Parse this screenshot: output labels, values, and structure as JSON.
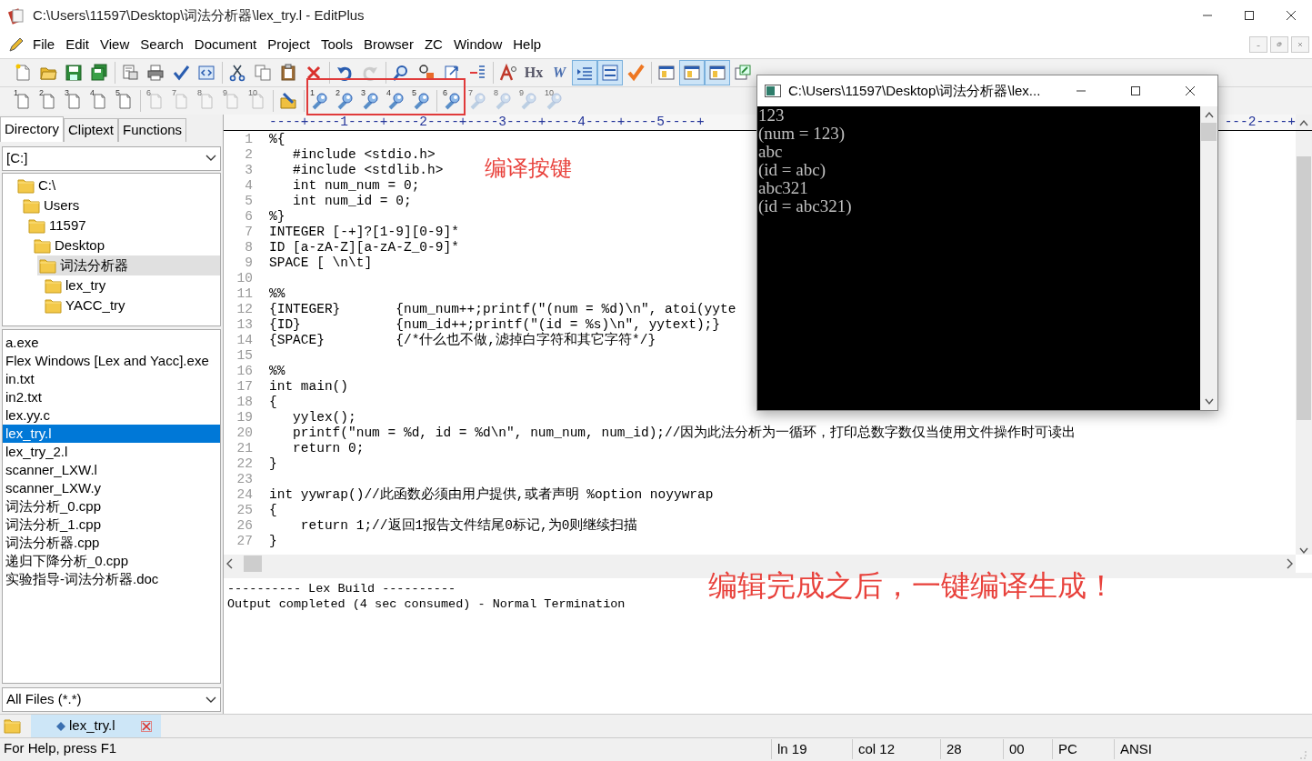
{
  "window": {
    "title": "C:\\Users\\11597\\Desktop\\词法分析器\\lex_try.l - EditPlus"
  },
  "menu": [
    "File",
    "Edit",
    "View",
    "Search",
    "Document",
    "Project",
    "Tools",
    "Browser",
    "ZC",
    "Window",
    "Help"
  ],
  "toolbar_main": [
    {
      "kind": "new",
      "pressed": false,
      "disabled": false
    },
    {
      "kind": "open",
      "pressed": false,
      "disabled": false
    },
    {
      "kind": "save",
      "pressed": false,
      "disabled": false
    },
    {
      "kind": "saveall",
      "pressed": false,
      "disabled": false
    },
    {
      "kind": "sep"
    },
    {
      "kind": "preview",
      "pressed": false,
      "disabled": false
    },
    {
      "kind": "print",
      "pressed": false,
      "disabled": false
    },
    {
      "kind": "spell",
      "pressed": false,
      "disabled": false
    },
    {
      "kind": "browser",
      "pressed": false,
      "disabled": false
    },
    {
      "kind": "sep"
    },
    {
      "kind": "cut",
      "pressed": false,
      "disabled": false
    },
    {
      "kind": "copy",
      "pressed": false,
      "disabled": false
    },
    {
      "kind": "paste",
      "pressed": false,
      "disabled": false
    },
    {
      "kind": "delete",
      "pressed": false,
      "disabled": false
    },
    {
      "kind": "sep"
    },
    {
      "kind": "undo",
      "pressed": false,
      "disabled": false
    },
    {
      "kind": "redo",
      "pressed": false,
      "disabled": true
    },
    {
      "kind": "sep"
    },
    {
      "kind": "find",
      "pressed": false,
      "disabled": false
    },
    {
      "kind": "replace",
      "pressed": false,
      "disabled": false
    },
    {
      "kind": "goto",
      "pressed": false,
      "disabled": false
    },
    {
      "kind": "linelist",
      "pressed": false,
      "disabled": false
    },
    {
      "kind": "sep"
    },
    {
      "kind": "font",
      "pressed": false,
      "disabled": false
    },
    {
      "kind": "hex",
      "label": "Hx",
      "pressed": false,
      "disabled": false
    },
    {
      "kind": "wrap",
      "label": "W",
      "pressed": false,
      "disabled": false
    },
    {
      "kind": "indent",
      "pressed": true,
      "disabled": false
    },
    {
      "kind": "linenum",
      "pressed": true,
      "disabled": false
    },
    {
      "kind": "check",
      "pressed": false,
      "disabled": false
    },
    {
      "kind": "sep"
    },
    {
      "kind": "pane",
      "pressed": false,
      "disabled": false
    },
    {
      "kind": "pane",
      "pressed": true,
      "disabled": false
    },
    {
      "kind": "pane",
      "pressed": true,
      "disabled": false
    },
    {
      "kind": "window",
      "pressed": false,
      "disabled": false
    }
  ],
  "toolbar_tools": [
    {
      "kind": "doc",
      "label": "1",
      "disabled": false
    },
    {
      "kind": "doc",
      "label": "2",
      "disabled": false
    },
    {
      "kind": "doc",
      "label": "3",
      "disabled": false
    },
    {
      "kind": "doc",
      "label": "4",
      "disabled": false
    },
    {
      "kind": "doc",
      "label": "5",
      "disabled": false
    },
    {
      "kind": "sep"
    },
    {
      "kind": "doc",
      "label": "6",
      "disabled": true
    },
    {
      "kind": "doc",
      "label": "7",
      "disabled": true
    },
    {
      "kind": "doc",
      "label": "8",
      "disabled": true
    },
    {
      "kind": "doc",
      "label": "9",
      "disabled": true
    },
    {
      "kind": "doc",
      "label": "10",
      "disabled": true
    },
    {
      "kind": "sep"
    },
    {
      "kind": "folder",
      "disabled": false
    },
    {
      "kind": "sep"
    },
    {
      "kind": "tool",
      "label": "1",
      "disabled": false
    },
    {
      "kind": "tool",
      "label": "2",
      "disabled": false
    },
    {
      "kind": "tool",
      "label": "3",
      "disabled": false
    },
    {
      "kind": "tool",
      "label": "4",
      "disabled": false
    },
    {
      "kind": "tool",
      "label": "5",
      "disabled": false
    },
    {
      "kind": "sep"
    },
    {
      "kind": "tool",
      "label": "6",
      "disabled": false
    },
    {
      "kind": "tool",
      "label": "7",
      "disabled": true
    },
    {
      "kind": "tool",
      "label": "8",
      "disabled": true
    },
    {
      "kind": "tool",
      "label": "9",
      "disabled": true
    },
    {
      "kind": "tool",
      "label": "10",
      "disabled": true
    }
  ],
  "sidebar": {
    "tabs": [
      {
        "label": "Directory",
        "selected": true
      },
      {
        "label": "Cliptext",
        "selected": false
      },
      {
        "label": "Functions",
        "selected": false
      }
    ],
    "drive": "[C:]",
    "tree": [
      {
        "label": "C:\\",
        "selected": false,
        "children": [
          {
            "label": "Users",
            "selected": false,
            "children": [
              {
                "label": "11597",
                "selected": false,
                "children": [
                  {
                    "label": "Desktop",
                    "selected": false,
                    "children": [
                      {
                        "label": "词法分析器",
                        "selected": true,
                        "children": [
                          {
                            "label": "lex_try",
                            "selected": false
                          },
                          {
                            "label": "YACC_try",
                            "selected": false
                          }
                        ]
                      }
                    ]
                  }
                ]
              }
            ]
          }
        ]
      }
    ],
    "files": [
      {
        "label": "a.exe",
        "selected": false
      },
      {
        "label": "Flex Windows [Lex and Yacc].exe",
        "selected": false
      },
      {
        "label": "in.txt",
        "selected": false
      },
      {
        "label": "in2.txt",
        "selected": false
      },
      {
        "label": "lex.yy.c",
        "selected": false
      },
      {
        "label": "lex_try.l",
        "selected": true
      },
      {
        "label": "lex_try_2.l",
        "selected": false
      },
      {
        "label": "scanner_LXW.l",
        "selected": false
      },
      {
        "label": "scanner_LXW.y",
        "selected": false
      },
      {
        "label": "词法分析_0.cpp",
        "selected": false
      },
      {
        "label": "词法分析_1.cpp",
        "selected": false
      },
      {
        "label": "词法分析器.cpp",
        "selected": false
      },
      {
        "label": "递归下降分析_0.cpp",
        "selected": false
      },
      {
        "label": "实验指导-词法分析器.doc",
        "selected": false
      }
    ],
    "filter": "All Files (*.*)"
  },
  "editor": {
    "ruler": "----+----1----+----2----+----3----+----4----+----5----+",
    "ruler_right": "---2----+",
    "lines": [
      {
        "num": "1",
        "text": "%{"
      },
      {
        "num": "2",
        "text": "   #include <stdio.h>"
      },
      {
        "num": "3",
        "text": "   #include <stdlib.h>"
      },
      {
        "num": "4",
        "text": "   int num_num = 0;"
      },
      {
        "num": "5",
        "text": "   int num_id = 0;"
      },
      {
        "num": "6",
        "text": "%}"
      },
      {
        "num": "7",
        "text": "INTEGER [-+]?[1-9][0-9]*"
      },
      {
        "num": "8",
        "text": "ID [a-zA-Z][a-zA-Z_0-9]*"
      },
      {
        "num": "9",
        "text": "SPACE [ \\n\\t]"
      },
      {
        "num": "10"
      },
      {
        "num": "11",
        "text": "%%"
      },
      {
        "num": "12",
        "text": "{INTEGER}       {num_num++;printf(\"(num = %d)\\n\", atoi(yyte"
      },
      {
        "num": "13",
        "text": "{ID}            {num_id++;printf(\"(id = %s)\\n\", yytext);}"
      },
      {
        "num": "14",
        "text": "{SPACE}         {/*什么也不做,滤掉白字符和其它字符*/}"
      },
      {
        "num": "15"
      },
      {
        "num": "16",
        "text": "%%"
      },
      {
        "num": "17",
        "text": "int main()"
      },
      {
        "num": "18",
        "text": "{"
      },
      {
        "num": "19",
        "text": "   yylex();"
      },
      {
        "num": "20",
        "text": "   printf(\"num = %d, id = %d\\n\", num_num, num_id);//因为此法分析为一循环，打印总数字数仅当使用文件操作时可读出"
      },
      {
        "num": "21",
        "text": "   return 0;"
      },
      {
        "num": "22",
        "text": "}"
      },
      {
        "num": "23"
      },
      {
        "num": "24",
        "text": "int yywrap()//此函数必须由用户提供,或者声明 %option noyywrap"
      },
      {
        "num": "25",
        "text": "{"
      },
      {
        "num": "26",
        "text": "    return 1;//返回1报告文件结尾0标记,为0则继续扫描"
      },
      {
        "num": "27",
        "text": "}"
      }
    ]
  },
  "output": {
    "lines": [
      "---------- Lex Build ----------",
      "Output completed (4 sec consumed) - Normal Termination"
    ]
  },
  "document_tabs": [
    {
      "label": "lex_try.l",
      "selected": true
    }
  ],
  "status_bar": [
    "For Help, press F1",
    "ln 19",
    "col 12",
    "28",
    "00",
    "PC",
    "ANSI"
  ],
  "console": {
    "title": "C:\\Users\\11597\\Desktop\\词法分析器\\lex...",
    "lines": [
      "123",
      "(num = 123)",
      "abc",
      "(id = abc)",
      "abc321",
      "(id = abc321)"
    ]
  },
  "annotations": [
    {
      "kind": "label",
      "text": "编译按键"
    },
    {
      "kind": "caption",
      "text": "编辑完成之后，一键编译生成！"
    },
    {
      "kind": "frame"
    }
  ]
}
